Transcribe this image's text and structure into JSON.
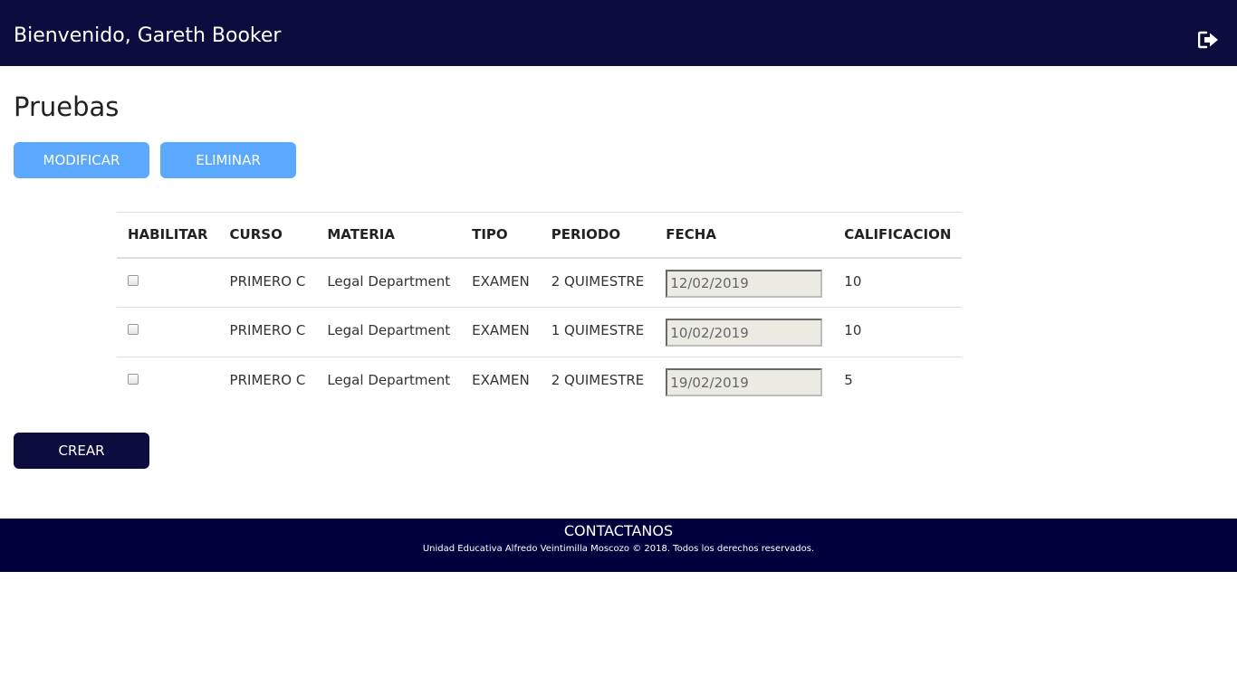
{
  "header": {
    "welcome": "Bienvenido, Gareth Booker",
    "logout_icon": "sign-out-icon"
  },
  "page": {
    "title": "Pruebas"
  },
  "actions": {
    "modificar": "MODIFICAR",
    "eliminar": "ELIMINAR",
    "crear": "CREAR"
  },
  "table": {
    "headers": [
      "HABILITAR",
      "CURSO",
      "MATERIA",
      "TIPO",
      "PERIODO",
      "FECHA",
      "CALIFICACION"
    ],
    "rows": [
      {
        "curso": "PRIMERO C",
        "materia": "Legal Department",
        "tipo": "EXAMEN",
        "periodo": "2 QUIMESTRE",
        "fecha": "12/02/2019",
        "calificacion": "10"
      },
      {
        "curso": "PRIMERO C",
        "materia": "Legal Department",
        "tipo": "EXAMEN",
        "periodo": "1 QUIMESTRE",
        "fecha": "10/02/2019",
        "calificacion": "10"
      },
      {
        "curso": "PRIMERO C",
        "materia": "Legal Department",
        "tipo": "EXAMEN",
        "periodo": "2 QUIMESTRE",
        "fecha": "19/02/2019",
        "calificacion": "5"
      }
    ]
  },
  "footer": {
    "title": "CONTACTANOS",
    "copyright": "Unidad Educativa Alfredo Veintimilla Moscozo © 2018. Todos los derechos reservados."
  },
  "colors": {
    "header_bg": "#0d0c3e",
    "button_light": "#5aa9ff",
    "button_dark": "#0d0c3e",
    "footer_bg": "#00003d"
  }
}
